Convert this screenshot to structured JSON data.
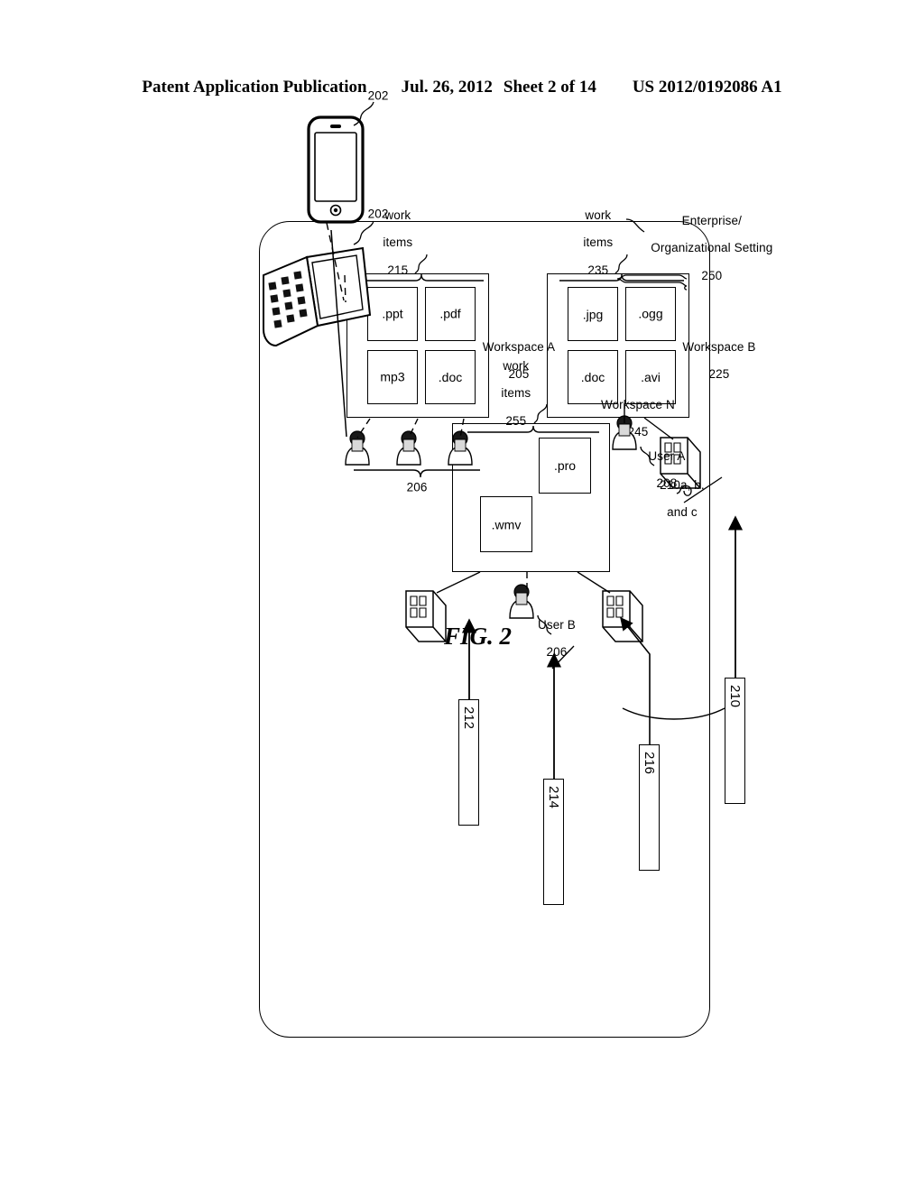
{
  "header": {
    "publication": "Patent Application Publication",
    "date": "Jul. 26, 2012",
    "sheet": "Sheet 2 of 14",
    "doc_number": "US 2012/0192086 A1"
  },
  "figure": {
    "caption": "FIG. 2",
    "enterprise_label_line1": "Enterprise/",
    "enterprise_label_line2": "Organizational Setting",
    "enterprise_ref": "250"
  },
  "workspaces": [
    {
      "id": "workspace-a",
      "name": "Workspace A",
      "ref": "205",
      "work_items_label_line1": "work",
      "work_items_label_line2": "items",
      "work_items_ref": "215",
      "items": [
        ".pdf",
        ".ppt",
        ".doc",
        "mp3"
      ]
    },
    {
      "id": "workspace-b",
      "name": "Workspace B",
      "ref": "225",
      "work_items_label_line1": "work",
      "work_items_label_line2": "items",
      "work_items_ref": "235",
      "items": [
        ".ogg",
        ".jpg",
        ".avi",
        ".doc"
      ]
    },
    {
      "id": "workspace-n",
      "name": "Workspace N",
      "ref": "245",
      "work_items_label_line1": "work",
      "work_items_label_line2": "items",
      "work_items_ref": "255",
      "items": [
        ".pro",
        ".wmv"
      ]
    }
  ],
  "users": {
    "group_ref": "206",
    "user_a_label": "User A",
    "user_a_ref": "208",
    "user_b_label": "User B",
    "user_b_ref": "206"
  },
  "devices": {
    "laptop_ref": "202",
    "phone_ref": "202"
  },
  "servers": {
    "group_label": "210a, b,",
    "group_label_line2": "and c"
  },
  "reference_boxes": [
    {
      "id": "ref-210",
      "ref": "210"
    },
    {
      "id": "ref-216",
      "ref": "216"
    },
    {
      "id": "ref-214",
      "ref": "214"
    },
    {
      "id": "ref-212",
      "ref": "212"
    }
  ],
  "colors": {
    "ink": "#000000",
    "paper": "#ffffff"
  }
}
